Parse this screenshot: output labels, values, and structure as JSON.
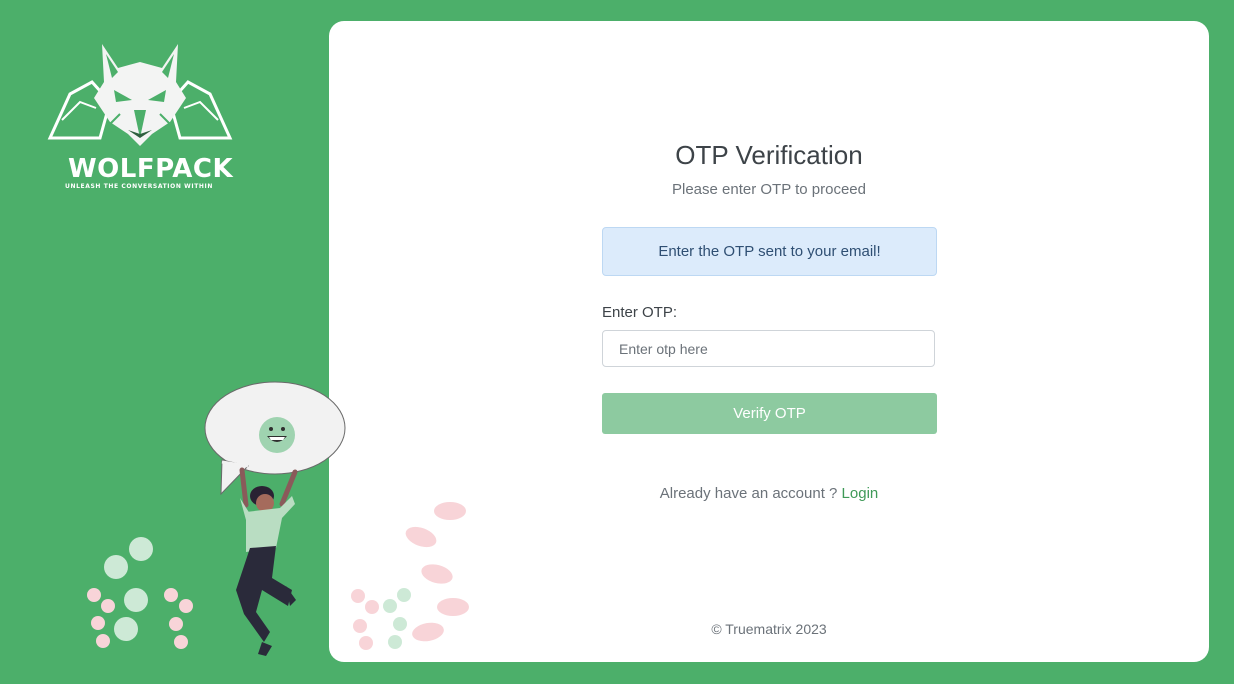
{
  "brand": {
    "logo_title": "WOLFPACK",
    "logo_tagline": "UNLEASH THE CONVERSATION WITHIN",
    "background_color": "#4caf6a"
  },
  "card": {
    "heading": "OTP Verification",
    "subheading": "Please enter OTP to proceed",
    "alert_text": "Enter the OTP sent to your email!",
    "otp_label": "Enter OTP:",
    "otp_placeholder": "Enter otp here",
    "otp_value": "",
    "verify_button_label": "Verify OTP",
    "login_prompt": "Already have an account ?",
    "login_link_label": "Login",
    "footer_text": "© Truematrix 2023"
  },
  "icons": {
    "logo": "wolf-head-icon",
    "speech_bubble_emoji": "smiling-face-icon"
  }
}
